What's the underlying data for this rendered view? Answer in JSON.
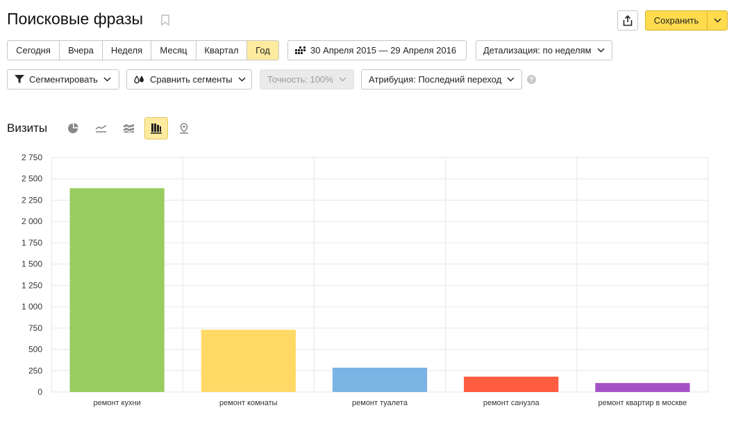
{
  "header": {
    "title": "Поисковые фразы",
    "save_label": "Сохранить"
  },
  "periods": [
    {
      "label": "Сегодня",
      "active": false
    },
    {
      "label": "Вчера",
      "active": false
    },
    {
      "label": "Неделя",
      "active": false
    },
    {
      "label": "Месяц",
      "active": false
    },
    {
      "label": "Квартал",
      "active": false
    },
    {
      "label": "Год",
      "active": true
    }
  ],
  "date_range": "30 Апреля 2015 — 29 Апреля 2016",
  "detail": "Детализация: по неделям",
  "toolbar": {
    "segment": "Сегментировать",
    "compare": "Сравнить сегменты",
    "accuracy": "Точность: 100%",
    "attribution": "Атрибуция: Последний переход"
  },
  "chart_section": {
    "title": "Визиты",
    "views": [
      "pie-chart-icon",
      "line-chart-icon",
      "area-chart-icon",
      "bar-chart-icon",
      "map-icon"
    ],
    "active_view": "bar-chart-icon"
  },
  "colors": {
    "accent": "#ffdb4d",
    "active_bg": "#ffeba0"
  },
  "chart_data": {
    "type": "bar",
    "categories": [
      "ремонт кухни",
      "ремонт комнаты",
      "ремонт туалета",
      "ремонт санузла",
      "ремонт квартир в москве"
    ],
    "values": [
      2390,
      730,
      285,
      180,
      105
    ],
    "colors": [
      "#99cc60",
      "#ffd966",
      "#7ab4e4",
      "#ff5c40",
      "#a353c4"
    ],
    "ylim": [
      0,
      2750
    ],
    "yticks": [
      0,
      250,
      500,
      750,
      1000,
      1250,
      1500,
      1750,
      2000,
      2250,
      2500,
      2750
    ],
    "ytick_labels": [
      "0",
      "250",
      "500",
      "750",
      "1 000",
      "1 250",
      "1 500",
      "1 750",
      "2 000",
      "2 250",
      "2 500",
      "2 750"
    ],
    "grid": true
  }
}
